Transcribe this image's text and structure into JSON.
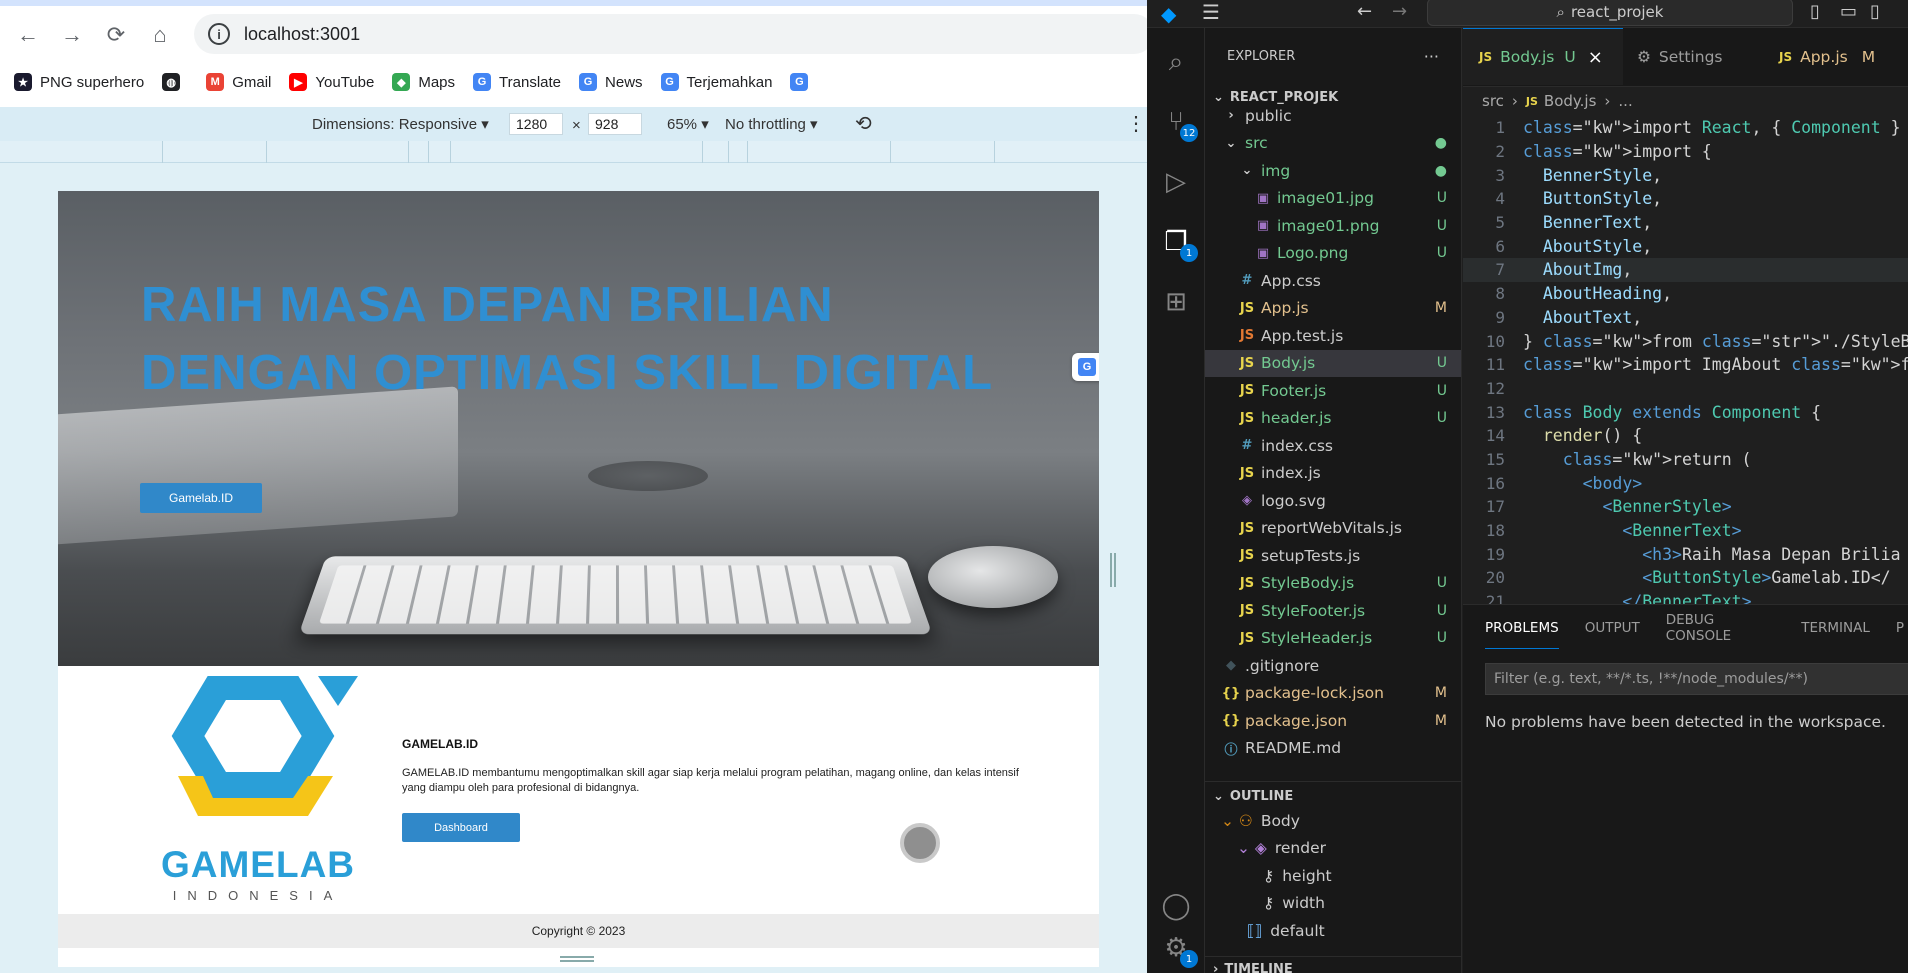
{
  "browser": {
    "url": "localhost:3001",
    "bookmarks": [
      {
        "label": "PNG superhero",
        "icon": "superhero-icon",
        "color": "#1a1a2e"
      },
      {
        "label": "",
        "icon": "globe-icon",
        "color": "#202124"
      },
      {
        "label": "Gmail",
        "icon": "gmail-icon",
        "color": "#ea4335"
      },
      {
        "label": "YouTube",
        "icon": "youtube-icon",
        "color": "#ff0000"
      },
      {
        "label": "Maps",
        "icon": "maps-icon",
        "color": "#34a853"
      },
      {
        "label": "Translate",
        "icon": "translate-icon",
        "color": "#4285f4"
      },
      {
        "label": "News",
        "icon": "news-icon",
        "color": "#4285f4"
      },
      {
        "label": "Terjemahkan",
        "icon": "translate-icon",
        "color": "#4285f4"
      },
      {
        "label": "",
        "icon": "translate-icon",
        "color": "#4285f4"
      }
    ],
    "devtools": {
      "dimensions_label": "Dimensions: Responsive",
      "width": "1280",
      "height": "928",
      "times": "×",
      "zoom": "65%",
      "throttle": "No throttling"
    }
  },
  "site": {
    "banner_heading": "RAIH MASA DEPAN BRILIAN DENGAN OPTIMASI SKILL DIGITAL",
    "banner_button": "Gamelab.ID",
    "logo_word": "GAMELAB",
    "logo_sub": "INDONESIA",
    "about_heading": "GAMELAB.ID",
    "about_text": "GAMELAB.ID membantumu mengoptimalkan skill agar siap kerja melalui program pelatihan, magang online, dan kelas intensif yang diampu oleh para profesional di bidangnya.",
    "about_button": "Dashboard",
    "footer": "Copyright © 2023",
    "brand_blue": "#2f8fd2"
  },
  "vscode": {
    "search": "react_projek",
    "activity_badges": {
      "source_control": "12",
      "explorer": "1",
      "settings": "1"
    },
    "explorer_title": "EXPLORER",
    "project": "REACT_PROJEK",
    "tree": [
      {
        "label": "public",
        "type": "folder",
        "indent": 1,
        "status": "",
        "color": "#ccc"
      },
      {
        "label": "src",
        "type": "folder-open",
        "indent": 1,
        "status": "●",
        "color": "#73c991"
      },
      {
        "label": "img",
        "type": "folder-open",
        "indent": 2,
        "status": "●",
        "color": "#73c991"
      },
      {
        "label": "image01.jpg",
        "type": "image",
        "indent": 3,
        "status": "U",
        "color": "#73c991"
      },
      {
        "label": "image01.png",
        "type": "image",
        "indent": 3,
        "status": "U",
        "color": "#73c991"
      },
      {
        "label": "Logo.png",
        "type": "image",
        "indent": 3,
        "status": "U",
        "color": "#73c991"
      },
      {
        "label": "App.css",
        "type": "css",
        "indent": 2,
        "status": "",
        "color": "#ccc"
      },
      {
        "label": "App.js",
        "type": "js",
        "indent": 2,
        "status": "M",
        "color": "#e2c08d"
      },
      {
        "label": "App.test.js",
        "type": "test",
        "indent": 2,
        "status": "",
        "color": "#ccc"
      },
      {
        "label": "Body.js",
        "type": "js",
        "indent": 2,
        "status": "U",
        "color": "#73c991",
        "selected": true
      },
      {
        "label": "Footer.js",
        "type": "js",
        "indent": 2,
        "status": "U",
        "color": "#73c991"
      },
      {
        "label": "header.js",
        "type": "js",
        "indent": 2,
        "status": "U",
        "color": "#73c991"
      },
      {
        "label": "index.css",
        "type": "css",
        "indent": 2,
        "status": "",
        "color": "#ccc"
      },
      {
        "label": "index.js",
        "type": "js",
        "indent": 2,
        "status": "",
        "color": "#ccc"
      },
      {
        "label": "logo.svg",
        "type": "svg",
        "indent": 2,
        "status": "",
        "color": "#ccc"
      },
      {
        "label": "reportWebVitals.js",
        "type": "js",
        "indent": 2,
        "status": "",
        "color": "#ccc"
      },
      {
        "label": "setupTests.js",
        "type": "js",
        "indent": 2,
        "status": "",
        "color": "#ccc"
      },
      {
        "label": "StyleBody.js",
        "type": "js",
        "indent": 2,
        "status": "U",
        "color": "#73c991"
      },
      {
        "label": "StyleFooter.js",
        "type": "js",
        "indent": 2,
        "status": "U",
        "color": "#73c991"
      },
      {
        "label": "StyleHeader.js",
        "type": "js",
        "indent": 2,
        "status": "U",
        "color": "#73c991"
      },
      {
        "label": ".gitignore",
        "type": "git",
        "indent": 1,
        "status": "",
        "color": "#ccc"
      },
      {
        "label": "package-lock.json",
        "type": "json",
        "indent": 1,
        "status": "M",
        "color": "#e2c08d"
      },
      {
        "label": "package.json",
        "type": "json",
        "indent": 1,
        "status": "M",
        "color": "#e2c08d"
      },
      {
        "label": "README.md",
        "type": "info",
        "indent": 1,
        "status": "",
        "color": "#ccc"
      }
    ],
    "outline_title": "OUTLINE",
    "outline": [
      {
        "label": "Body",
        "indent": 1
      },
      {
        "label": "render",
        "indent": 2
      },
      {
        "label": "height",
        "indent": 3
      },
      {
        "label": "width",
        "indent": 3
      },
      {
        "label": "default",
        "indent": 2
      }
    ],
    "timeline_title": "TIMELINE",
    "tabs": [
      {
        "label": "Body.js",
        "status": "U",
        "active": true
      },
      {
        "label": "Settings",
        "status": "",
        "active": false
      },
      {
        "label": "App.js",
        "status": "M",
        "active": false
      }
    ],
    "breadcrumb": [
      "src",
      "Body.js",
      "..."
    ],
    "code": [
      "import React, { Component } from \"react",
      "import {",
      "  BennerStyle,",
      "  ButtonStyle,",
      "  BennerText,",
      "  AboutStyle,",
      "  AboutImg,",
      "  AboutHeading,",
      "  AboutText,",
      "} from \"./StyleBody\";",
      "import ImgAbout from \"./img/Logo.png\"",
      "",
      "class Body extends Component {",
      "  render() {",
      "    return (",
      "      <body>",
      "        <BennerStyle>",
      "          <BennerText>",
      "            <h3>Raih Masa Depan Brilia",
      "            <ButtonStyle>Gamelab.ID</",
      "          </BennerText>"
    ],
    "panel_tabs": [
      "PROBLEMS",
      "OUTPUT",
      "DEBUG CONSOLE",
      "TERMINAL",
      "P"
    ],
    "filter_placeholder": "Filter (e.g. text, **/*.ts, !**/node_modules/**)",
    "no_problems": "No problems have been detected in the workspace."
  }
}
